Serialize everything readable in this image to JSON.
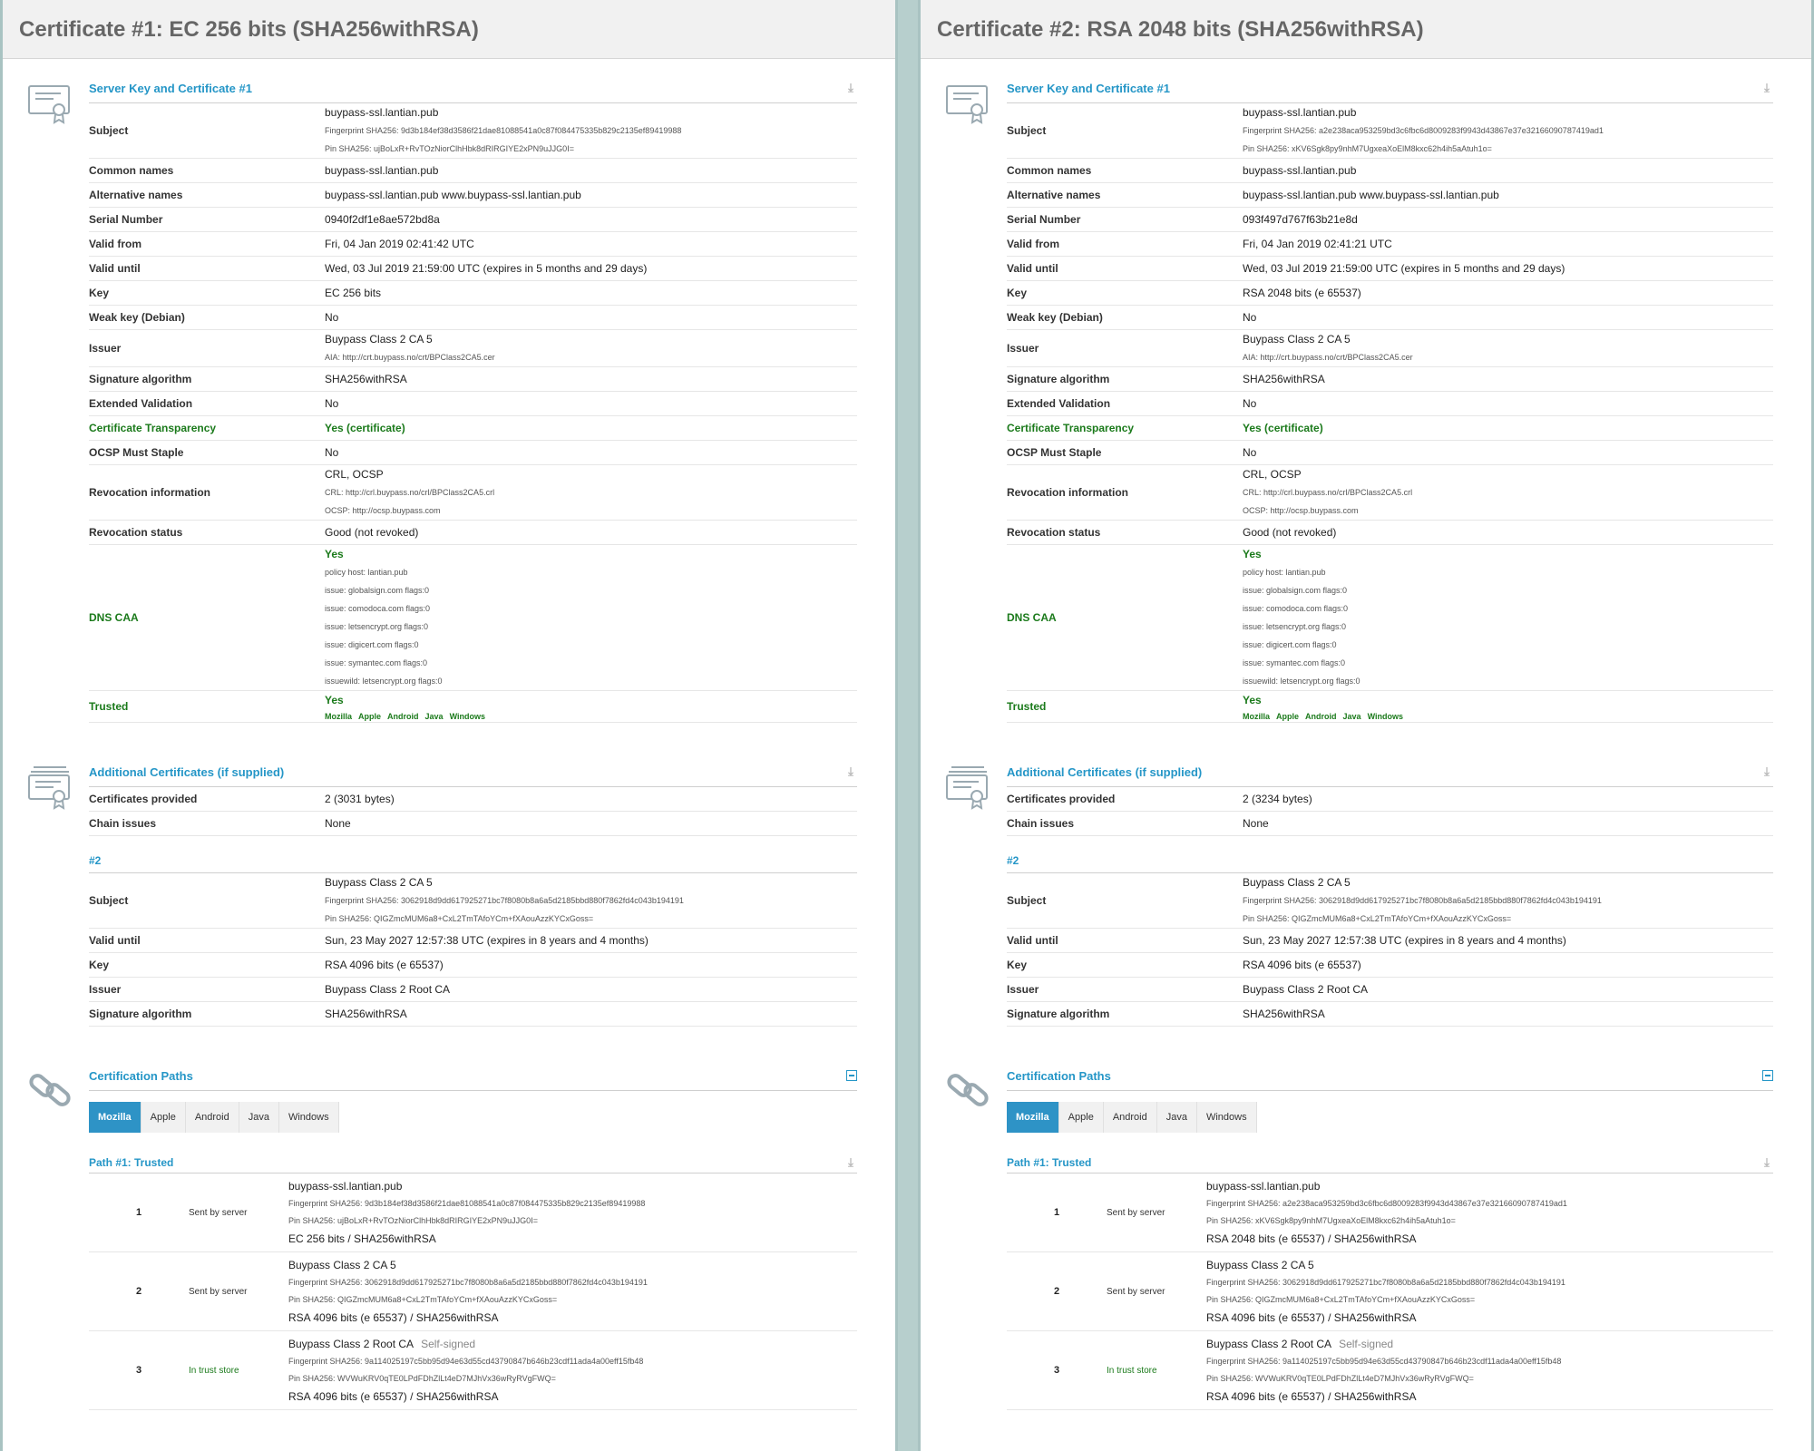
{
  "certs": [
    {
      "header": "Certificate #1: EC 256 bits (SHA256withRSA)",
      "server_section_title": "Server Key and Certificate #1",
      "subject": {
        "label": "Subject",
        "name": "buypass-ssl.lantian.pub",
        "fingerprint": "Fingerprint SHA256: 9d3b184ef38d3586f21dae81088541a0c87f084475335b829c2135ef89419988",
        "pin": "Pin SHA256: ujBoLxR+RvTOzNiorClhHbk8dRIRGIYE2xPN9uJJG0I="
      },
      "common_names": {
        "label": "Common names",
        "value": "buypass-ssl.lantian.pub"
      },
      "alt_names": {
        "label": "Alternative names",
        "value": "buypass-ssl.lantian.pub www.buypass-ssl.lantian.pub"
      },
      "serial": {
        "label": "Serial Number",
        "value": "0940f2df1e8ae572bd8a"
      },
      "valid_from": {
        "label": "Valid from",
        "value": "Fri, 04 Jan 2019 02:41:42 UTC"
      },
      "valid_until": {
        "label": "Valid until",
        "value": "Wed, 03 Jul 2019 21:59:00 UTC (expires in 5 months and 29 days)"
      },
      "key": {
        "label": "Key",
        "value": "EC 256 bits"
      },
      "weak_key": {
        "label": "Weak key (Debian)",
        "value": "No"
      },
      "issuer": {
        "label": "Issuer",
        "value": "Buypass Class 2 CA 5",
        "aia": "AIA: http://crt.buypass.no/crt/BPClass2CA5.cer"
      },
      "sig_alg": {
        "label": "Signature algorithm",
        "value": "SHA256withRSA"
      },
      "ev": {
        "label": "Extended Validation",
        "value": "No"
      },
      "ct": {
        "label": "Certificate Transparency",
        "value": "Yes (certificate)"
      },
      "ocsp_staple": {
        "label": "OCSP Must Staple",
        "value": "No"
      },
      "revocation_info": {
        "label": "Revocation information",
        "value": "CRL, OCSP",
        "crl": "CRL: http://crl.buypass.no/crl/BPClass2CA5.crl",
        "ocsp": "OCSP: http://ocsp.buypass.com"
      },
      "revocation_status": {
        "label": "Revocation status",
        "value": "Good (not revoked)"
      },
      "dns_caa": {
        "label": "DNS CAA",
        "value": "Yes",
        "records": [
          "policy host: lantian.pub",
          "issue: globalsign.com flags:0",
          "issue: comodoca.com flags:0",
          "issue: letsencrypt.org flags:0",
          "issue: digicert.com flags:0",
          "issue: symantec.com flags:0",
          "issuewild: letsencrypt.org flags:0"
        ]
      },
      "trusted": {
        "label": "Trusted",
        "value": "Yes",
        "stores": [
          "Mozilla",
          "Apple",
          "Android",
          "Java",
          "Windows"
        ]
      },
      "additional": {
        "title": "Additional Certificates (if supplied)",
        "provided": {
          "label": "Certificates provided",
          "value": "2 (3031 bytes)"
        },
        "chain": {
          "label": "Chain issues",
          "value": "None"
        },
        "num": "#2",
        "subject": {
          "label": "Subject",
          "name": "Buypass Class 2 CA 5",
          "fingerprint": "Fingerprint SHA256: 3062918d9dd617925271bc7f8080b8a6a5d2185bbd880f7862fd4c043b194191",
          "pin": "Pin SHA256: QIGZmcMUM6a8+CxL2TmTAfoYCm+fXAouAzzKYCxGoss="
        },
        "valid_until": {
          "label": "Valid until",
          "value": "Sun, 23 May 2027 12:57:38 UTC (expires in 8 years and 4 months)"
        },
        "key": {
          "label": "Key",
          "value": "RSA 4096 bits (e 65537)"
        },
        "issuer": {
          "label": "Issuer",
          "value": "Buypass Class 2 Root CA"
        },
        "sig_alg": {
          "label": "Signature algorithm",
          "value": "SHA256withRSA"
        }
      },
      "paths": {
        "title": "Certification Paths",
        "tabs": [
          "Mozilla",
          "Apple",
          "Android",
          "Java",
          "Windows"
        ],
        "active_tab": "Mozilla",
        "path_title": "Path #1: Trusted",
        "rows": [
          {
            "num": "1",
            "how": "Sent by server",
            "name": "buypass-ssl.lantian.pub",
            "selfsigned": "",
            "fingerprint": "Fingerprint SHA256: 9d3b184ef38d3586f21dae81088541a0c87f084475335b829c2135ef89419988",
            "pin": "Pin SHA256: ujBoLxR+RvTOzNiorClhHbk8dRIRGIYE2xPN9uJJG0I=",
            "key": "EC 256 bits / SHA256withRSA"
          },
          {
            "num": "2",
            "how": "Sent by server",
            "name": "Buypass Class 2 CA 5",
            "selfsigned": "",
            "fingerprint": "Fingerprint SHA256: 3062918d9dd617925271bc7f8080b8a6a5d2185bbd880f7862fd4c043b194191",
            "pin": "Pin SHA256: QIGZmcMUM6a8+CxL2TmTAfoYCm+fXAouAzzKYCxGoss=",
            "key": "RSA 4096 bits (e 65537) / SHA256withRSA"
          },
          {
            "num": "3",
            "how": "In trust store",
            "name": "Buypass Class 2 Root CA",
            "selfsigned": "Self-signed",
            "fingerprint": "Fingerprint SHA256: 9a114025197c5bb95d94e63d55cd43790847b646b23cdf11ada4a00eff15fb48",
            "pin": "Pin SHA256: WVWuKRV0qTE0LPdFDhZlLt4eD7MJhVx36wRyRVgFWQ=",
            "key": "RSA 4096 bits (e 65537) / SHA256withRSA"
          }
        ]
      }
    },
    {
      "header": "Certificate #2: RSA 2048 bits (SHA256withRSA)",
      "server_section_title": "Server Key and Certificate #1",
      "subject": {
        "label": "Subject",
        "name": "buypass-ssl.lantian.pub",
        "fingerprint": "Fingerprint SHA256: a2e238aca953259bd3c6fbc6d8009283f9943d43867e37e32166090787419ad1",
        "pin": "Pin SHA256: xKV6Sgk8py9nhM7UgxeaXoElM8kxc62h4ih5aAtuh1o="
      },
      "common_names": {
        "label": "Common names",
        "value": "buypass-ssl.lantian.pub"
      },
      "alt_names": {
        "label": "Alternative names",
        "value": "buypass-ssl.lantian.pub www.buypass-ssl.lantian.pub"
      },
      "serial": {
        "label": "Serial Number",
        "value": "093f497d767f63b21e8d"
      },
      "valid_from": {
        "label": "Valid from",
        "value": "Fri, 04 Jan 2019 02:41:21 UTC"
      },
      "valid_until": {
        "label": "Valid until",
        "value": "Wed, 03 Jul 2019 21:59:00 UTC (expires in 5 months and 29 days)"
      },
      "key": {
        "label": "Key",
        "value": "RSA 2048 bits (e 65537)"
      },
      "weak_key": {
        "label": "Weak key (Debian)",
        "value": "No"
      },
      "issuer": {
        "label": "Issuer",
        "value": "Buypass Class 2 CA 5",
        "aia": "AIA: http://crt.buypass.no/crt/BPClass2CA5.cer"
      },
      "sig_alg": {
        "label": "Signature algorithm",
        "value": "SHA256withRSA"
      },
      "ev": {
        "label": "Extended Validation",
        "value": "No"
      },
      "ct": {
        "label": "Certificate Transparency",
        "value": "Yes (certificate)"
      },
      "ocsp_staple": {
        "label": "OCSP Must Staple",
        "value": "No"
      },
      "revocation_info": {
        "label": "Revocation information",
        "value": "CRL, OCSP",
        "crl": "CRL: http://crl.buypass.no/crl/BPClass2CA5.crl",
        "ocsp": "OCSP: http://ocsp.buypass.com"
      },
      "revocation_status": {
        "label": "Revocation status",
        "value": "Good (not revoked)"
      },
      "dns_caa": {
        "label": "DNS CAA",
        "value": "Yes",
        "records": [
          "policy host: lantian.pub",
          "issue: globalsign.com flags:0",
          "issue: comodoca.com flags:0",
          "issue: letsencrypt.org flags:0",
          "issue: digicert.com flags:0",
          "issue: symantec.com flags:0",
          "issuewild: letsencrypt.org flags:0"
        ]
      },
      "trusted": {
        "label": "Trusted",
        "value": "Yes",
        "stores": [
          "Mozilla",
          "Apple",
          "Android",
          "Java",
          "Windows"
        ]
      },
      "additional": {
        "title": "Additional Certificates (if supplied)",
        "provided": {
          "label": "Certificates provided",
          "value": "2 (3234 bytes)"
        },
        "chain": {
          "label": "Chain issues",
          "value": "None"
        },
        "num": "#2",
        "subject": {
          "label": "Subject",
          "name": "Buypass Class 2 CA 5",
          "fingerprint": "Fingerprint SHA256: 3062918d9dd617925271bc7f8080b8a6a5d2185bbd880f7862fd4c043b194191",
          "pin": "Pin SHA256: QIGZmcMUM6a8+CxL2TmTAfoYCm+fXAouAzzKYCxGoss="
        },
        "valid_until": {
          "label": "Valid until",
          "value": "Sun, 23 May 2027 12:57:38 UTC (expires in 8 years and 4 months)"
        },
        "key": {
          "label": "Key",
          "value": "RSA 4096 bits (e 65537)"
        },
        "issuer": {
          "label": "Issuer",
          "value": "Buypass Class 2 Root CA"
        },
        "sig_alg": {
          "label": "Signature algorithm",
          "value": "SHA256withRSA"
        }
      },
      "paths": {
        "title": "Certification Paths",
        "tabs": [
          "Mozilla",
          "Apple",
          "Android",
          "Java",
          "Windows"
        ],
        "active_tab": "Mozilla",
        "path_title": "Path #1: Trusted",
        "rows": [
          {
            "num": "1",
            "how": "Sent by server",
            "name": "buypass-ssl.lantian.pub",
            "selfsigned": "",
            "fingerprint": "Fingerprint SHA256: a2e238aca953259bd3c6fbc6d8009283f9943d43867e37e32166090787419ad1",
            "pin": "Pin SHA256: xKV6Sgk8py9nhM7UgxeaXoElM8kxc62h4ih5aAtuh1o=",
            "key": "RSA 2048 bits (e 65537) / SHA256withRSA"
          },
          {
            "num": "2",
            "how": "Sent by server",
            "name": "Buypass Class 2 CA 5",
            "selfsigned": "",
            "fingerprint": "Fingerprint SHA256: 3062918d9dd617925271bc7f8080b8a6a5d2185bbd880f7862fd4c043b194191",
            "pin": "Pin SHA256: QIGZmcMUM6a8+CxL2TmTAfoYCm+fXAouAzzKYCxGoss=",
            "key": "RSA 4096 bits (e 65537) / SHA256withRSA"
          },
          {
            "num": "3",
            "how": "In trust store",
            "name": "Buypass Class 2 Root CA",
            "selfsigned": "Self-signed",
            "fingerprint": "Fingerprint SHA256: 9a114025197c5bb95d94e63d55cd43790847b646b23cdf11ada4a00eff15fb48",
            "pin": "Pin SHA256: WVWuKRV0qTE0LPdFDhZlLt4eD7MJhVx36wRyRVgFWQ=",
            "key": "RSA 4096 bits (e 65537) / SHA256withRSA"
          }
        ]
      }
    }
  ],
  "icons": {
    "certificate": "certificate-icon",
    "certificates": "certificates-stack-icon",
    "paths": "chain-link-icon",
    "download": "download-icon",
    "collapse": "collapse-icon"
  },
  "colors": {
    "accent": "#2596c7",
    "trusted": "#1b7a1b",
    "tab_active": "#2e93c6",
    "header_text": "#666666"
  }
}
